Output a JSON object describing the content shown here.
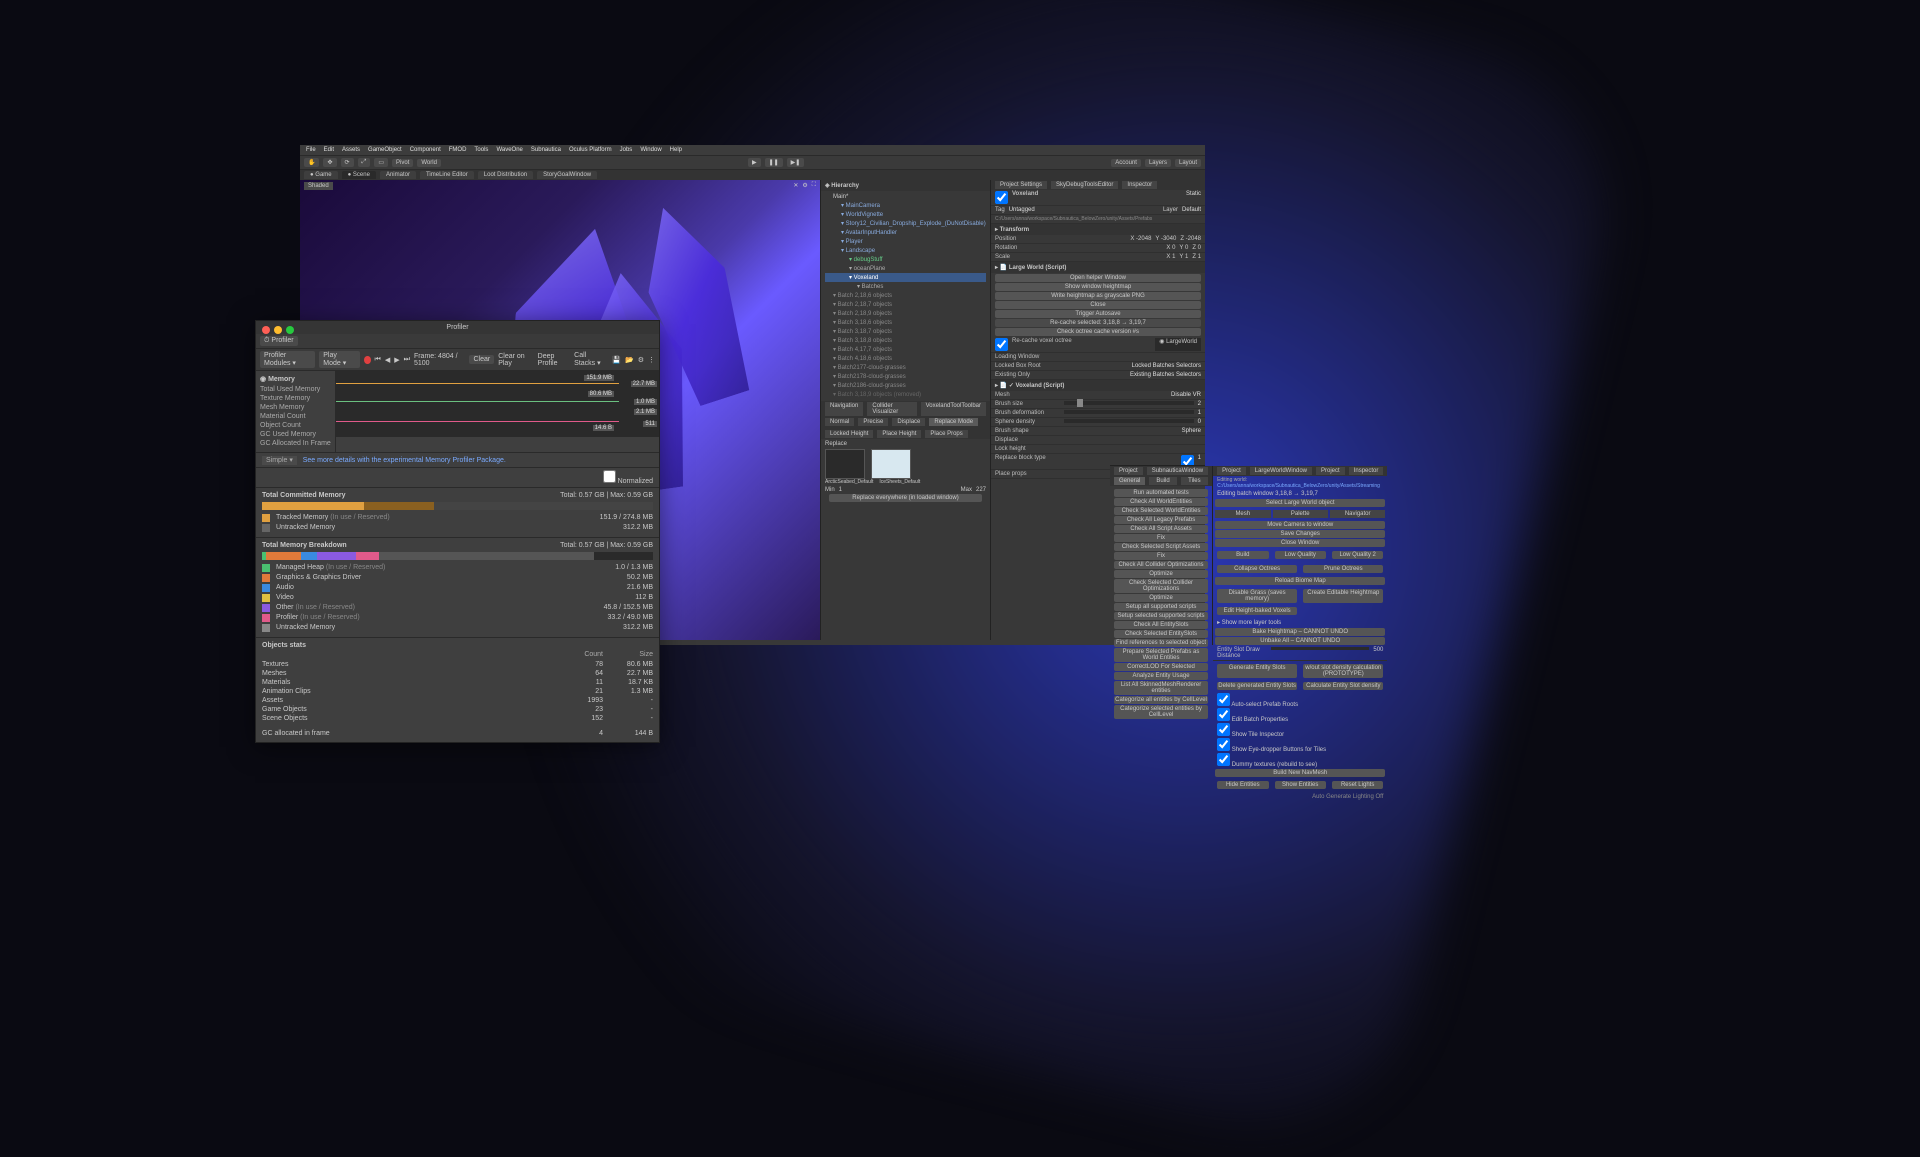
{
  "menubar": [
    "File",
    "Edit",
    "Assets",
    "GameObject",
    "Component",
    "FMOD",
    "Tools",
    "WaveOne",
    "Subnautica",
    "Oculus Platform",
    "Jobs",
    "Window",
    "Help"
  ],
  "toolbar": {
    "pivot": "Pivot",
    "world": "World",
    "account": "Account",
    "layers": "Layers",
    "layout": "Layout",
    "shaded": "Shaded"
  },
  "tabs": [
    "Game",
    "Scene",
    "Animator",
    "TimeLine Editor",
    "Loot Distribution",
    "StoryGoalWindow"
  ],
  "right_tabs": [
    "Project Settings",
    "SkyDebugToolsEditor",
    "Inspector"
  ],
  "hierarchy": {
    "title": "Hierarchy",
    "nav_tabs": [
      "Navigation",
      "Collider Visualizer",
      "VoxelandToolToolbar"
    ],
    "mode_tabs": [
      "Normal",
      "Precise",
      "Displace",
      "Replace Mode",
      "Locked Height",
      "Place Height",
      "Place Props"
    ],
    "replace_label": "Replace",
    "min_label": "Min",
    "min_val": "1",
    "max_label": "Max",
    "max_val": "227",
    "preset_a": "ArcticSeabed_Default",
    "preset_b": "IceSheets_Default",
    "replace_hint": "Replace everywhere (in loaded window)",
    "items": [
      {
        "t": "Main*",
        "d": 0
      },
      {
        "t": "MainCamera",
        "d": 1,
        "c": "#8ad"
      },
      {
        "t": "WorldVignette",
        "d": 1,
        "c": "#8ad"
      },
      {
        "t": "Story12_Civilian_Dropship_Explode_(DuNotDisable)",
        "d": 1,
        "c": "#8ad"
      },
      {
        "t": "AvatarInputHandler",
        "d": 1,
        "c": "#8ad"
      },
      {
        "t": "Player",
        "d": 1,
        "c": "#8ad"
      },
      {
        "t": "Landscape",
        "d": 1,
        "c": "#8ad"
      },
      {
        "t": "debugStuff",
        "d": 2,
        "c": "#6c8"
      },
      {
        "t": "oceanPlane",
        "d": 2,
        "c": "#aaa"
      },
      {
        "t": "Voxeland",
        "d": 2,
        "c": "#fff",
        "sel": true
      },
      {
        "t": "Batches",
        "d": 3,
        "c": "#aaa"
      },
      {
        "t": "Batch 2,18,6 objects",
        "d": 4,
        "c": "#888"
      },
      {
        "t": "Batch 2,18,7 objects",
        "d": 4,
        "c": "#888"
      },
      {
        "t": "Batch 2,18,9 objects",
        "d": 4,
        "c": "#888"
      },
      {
        "t": "Batch 3,18,6 objects",
        "d": 4,
        "c": "#888"
      },
      {
        "t": "Batch 3,18,7 objects",
        "d": 4,
        "c": "#888"
      },
      {
        "t": "Batch 3,18,8 objects",
        "d": 4,
        "c": "#888"
      },
      {
        "t": "Batch 4,17,7 objects",
        "d": 4,
        "c": "#888"
      },
      {
        "t": "Batch 4,18,6 objects",
        "d": 4,
        "c": "#888"
      },
      {
        "t": "Batch2177-cloud-grasses",
        "d": 4,
        "c": "#888"
      },
      {
        "t": "Batch2178-cloud-grasses",
        "d": 4,
        "c": "#888"
      },
      {
        "t": "Batch2186-cloud-grasses",
        "d": 4,
        "c": "#888"
      },
      {
        "t": "Batch 3,18,9 objects (removed)",
        "d": 4,
        "c": "#666"
      }
    ]
  },
  "inspector": {
    "name": "Voxeland",
    "static": "Static",
    "tag_lbl": "Tag",
    "tag": "Untagged",
    "layer_lbl": "Layer",
    "layer": "Default",
    "path": "C:/Users/anna/workspace/Subnautica_BelowZero/unity/Assets/Prefabs",
    "transform": {
      "title": "Transform",
      "position": {
        "lbl": "Position",
        "x": "X  -2048",
        "y": "Y  -3040",
        "z": "Z  -2048"
      },
      "rotation": {
        "lbl": "Rotation",
        "x": "X  0",
        "y": "Y  0",
        "z": "Z  0"
      },
      "scale": {
        "lbl": "Scale",
        "x": "X  1",
        "y": "Y  1",
        "z": "Z  1"
      }
    },
    "largeworld": {
      "title": "Large World (Script)",
      "buttons": [
        "Open helper Window",
        "Show window heightmap",
        "Write heightmap as grayscale PNG",
        "Close",
        "Trigger Autosave"
      ],
      "recache": "Re-cache selected: 3,18,8 → 3,19,7",
      "checkver": "Check octree cache version #s",
      "recache_cb": "Re-cache voxel octree",
      "lw": "LargeWorld",
      "loading": "Loading Window",
      "locked_root": "Locked Box Root",
      "locked_sel": "Locked Batches Selectors",
      "existing": "Existing Only",
      "existing_sel": "Existing Batches Selectors"
    },
    "voxeland": {
      "title": "Voxeland (Script)",
      "mesh_lbl": "Mesh",
      "disable_vr": "Disable VR",
      "brush_size": "Brush size",
      "brush_size_v": "2",
      "brush_def": "Brush deformation",
      "brush_def_v": "1",
      "sphere_dens": "Sphere density",
      "sphere_dens_v": "0",
      "brush_shape": "Brush shape",
      "brush_shape_v": "Sphere",
      "displace": "Displace",
      "lock_height": "Lock height",
      "replace_bt": "Replace block type",
      "replace_bt_v": "1",
      "place_props": "Place props"
    }
  },
  "projectA": {
    "tabs": [
      "Project",
      "SubnauticaWindow"
    ],
    "subtabs": [
      "General",
      "Build",
      "Tiles"
    ],
    "buttons": [
      "Run automated tests",
      "Check All WorldEntities",
      "Check Selected WorldEntities",
      "Check All Legacy Prefabs",
      "Check All Script Assets",
      "Fix",
      "Check Selected Script Assets",
      "Fix",
      "Check All Collider Optimizations",
      "Optimize",
      "Check Selected Collider Optimizations",
      "Optimize",
      "Setup all supported scripts",
      "Setup selected supported scripts",
      "Check All EntitySlots",
      "Check Selected EntitySlots",
      "Find references to selected object",
      "Prepare Selected Prefabs as World Entities",
      "CorrectLOD For Selected",
      "Analyze Entity Usage",
      "List All SkinnedMeshRenderer entities",
      "Categorize all entities by CellLevel",
      "Categorize selected entities by CellLevel"
    ]
  },
  "projectB": {
    "tabs": [
      "Project",
      "LargeWorldWindow",
      "Project",
      "Inspector"
    ],
    "editing": "Editing world:",
    "editing_path": "C:/Users/anna/workspace/Subnautica_BelowZero/unity/Assets/Streaming",
    "batch": "Editing batch window 3,18,8 → 3,19,7",
    "cols": [
      "Mesh",
      "Palette",
      "Navigator"
    ],
    "group0": [
      "Move Camera to window",
      "Save Changes",
      "Close Window"
    ],
    "group1": [
      "Build",
      "Low Quality",
      "Low Quality 2"
    ],
    "group2": [
      "Collapse Octrees",
      "Prune Octrees"
    ],
    "group3": [
      "Reload Biome Map"
    ],
    "group4": [
      "Disable Grass (saves memory)",
      "Create Editable Heightmap",
      "Edit Height-baked Voxels"
    ],
    "more": "Show more layer tools",
    "group5": [
      "Bake Heightmap – CANNOT UNDO",
      "Unbake All – CANNOT UNDO"
    ],
    "slotdraw": "Entity Slot Draw Distance",
    "slotdraw_v": "500",
    "group6": [
      "Generate Entity Slots",
      "w/out slot density calculation (PROTOTYPE)",
      "Delete generated Entity Slots",
      "Calculate Entity Slot density"
    ],
    "cb": [
      "Auto-select Prefab Roots",
      "Edit Batch Properties",
      "Show Tile Inspector",
      "Show Eye-dropper Buttons for Tiles",
      "Dummy textures (rebuild to see)"
    ],
    "group7": [
      "Build New NavMesh"
    ],
    "group8": [
      "Hide Entities",
      "Show Entities",
      "Reset Lights"
    ],
    "footer": "Auto Generate Lighting Off"
  },
  "profiler": {
    "title": "Profiler",
    "tab": "Profiler",
    "modules_lbl": "Profiler Modules",
    "playmode": "Play Mode",
    "frame": "Frame: 4804 / 5100",
    "clear": "Clear",
    "clearplay": "Clear on Play",
    "deep": "Deep Profile",
    "callstacks": "Call Stacks",
    "memory_head": "Memory",
    "memory_items": [
      "Total Used Memory",
      "Texture Memory",
      "Mesh Memory",
      "Material Count",
      "Object Count",
      "GC Used Memory",
      "GC Allocated In Frame"
    ],
    "graph_labels": [
      "151.9 MB",
      "22.7 MB",
      "80.6 MB",
      "1.0 MB",
      "2.1 MB",
      "14.6 B",
      "511"
    ],
    "simple": "Simple",
    "note": "See more details with the experimental Memory Profiler Package.",
    "normalized": "Normalized",
    "committed": {
      "title": "Total Committed Memory",
      "summary": "Total: 0.57 GB | Max: 0.59 GB",
      "tracked": "Tracked Memory",
      "tracked_sub": "(In use / Reserved)",
      "tracked_v": "151.9 / 274.8 MB",
      "untracked": "Untracked Memory",
      "untracked_v": "312.2 MB"
    },
    "breakdown": {
      "title": "Total Memory Breakdown",
      "summary": "Total: 0.57 GB | Max: 0.59 GB",
      "rows": [
        {
          "k": "Managed Heap",
          "sub": "(In use / Reserved)",
          "v": "1.0 / 1.3 MB",
          "c": "#4ac070"
        },
        {
          "k": "Graphics & Graphics Driver",
          "v": "50.2 MB",
          "c": "#e07a3a"
        },
        {
          "k": "Audio",
          "v": "21.6 MB",
          "c": "#3a8ae0"
        },
        {
          "k": "Video",
          "v": "112 B",
          "c": "#e0c040"
        },
        {
          "k": "Other",
          "sub": "(In use / Reserved)",
          "v": "45.8 / 152.5 MB",
          "c": "#8a5ae0"
        },
        {
          "k": "Profiler",
          "sub": "(In use / Reserved)",
          "v": "33.2 / 49.0 MB",
          "c": "#e05a8a"
        },
        {
          "k": "Untracked Memory",
          "v": "312.2 MB",
          "c": "#888"
        }
      ]
    },
    "objects": {
      "title": "Objects stats",
      "cols": [
        "",
        "Count",
        "Size"
      ],
      "rows": [
        {
          "k": "Textures",
          "c": "78",
          "s": "80.6 MB"
        },
        {
          "k": "Meshes",
          "c": "64",
          "s": "22.7 MB"
        },
        {
          "k": "Materials",
          "c": "11",
          "s": "18.7 KB"
        },
        {
          "k": "Animation Clips",
          "c": "21",
          "s": "1.3 MB"
        },
        {
          "k": "Assets",
          "c": "1993",
          "s": "-"
        },
        {
          "k": "Game Objects",
          "c": "23",
          "s": "-"
        },
        {
          "k": "Scene Objects",
          "c": "152",
          "s": "-"
        }
      ],
      "gc": {
        "k": "GC allocated in frame",
        "c": "4",
        "s": "144 B"
      }
    }
  }
}
